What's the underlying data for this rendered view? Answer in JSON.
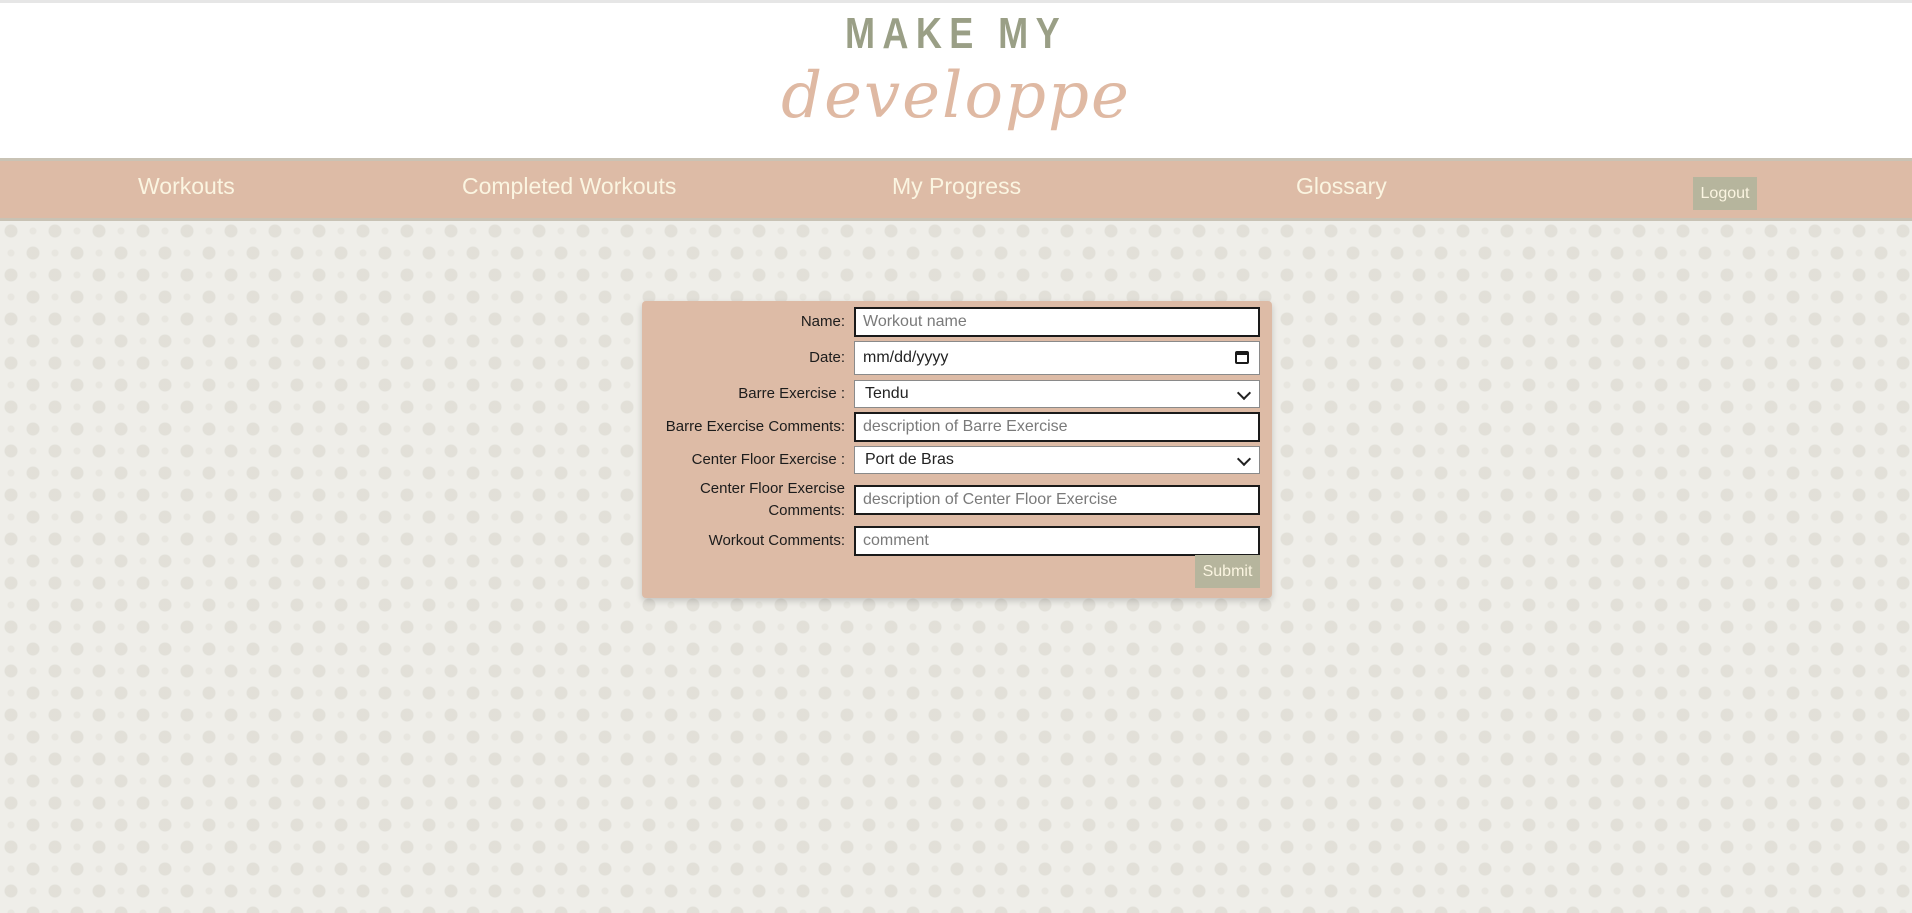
{
  "logo": {
    "line1": "MAKE MY",
    "line2": "developpe"
  },
  "nav": {
    "items": [
      {
        "label": "Workouts"
      },
      {
        "label": "Completed Workouts"
      },
      {
        "label": "My Progress"
      },
      {
        "label": "Glossary"
      }
    ],
    "logout_label": "Logout"
  },
  "form": {
    "name_label": "Name:",
    "name_placeholder": "Workout name",
    "date_label": "Date:",
    "date_value": "mm/dd/yyyy",
    "barre_label": "Barre Exercise :",
    "barre_selected": "Tendu",
    "barre_comments_label": "Barre Exercise Comments:",
    "barre_comments_placeholder": "description of Barre Exercise",
    "center_label": "Center Floor Exercise :",
    "center_selected": "Port de Bras",
    "center_comments_label_line1": "Center Floor Exercise",
    "center_comments_label_line2": "Comments:",
    "center_comments_placeholder": "description of Center Floor Exercise",
    "workout_comments_label": "Workout Comments:",
    "workout_comments_placeholder": "comment",
    "submit_label": "Submit"
  },
  "colors": {
    "accent": "#ddbba6",
    "button": "#b6b59d",
    "nav_text": "#fbf5e1",
    "logo_green": "#9a9f86",
    "logo_pink": "#dfb9a3",
    "page_bg": "#efeee9"
  },
  "icons": {
    "date_picker": "calendar-icon",
    "select_arrow": "chevron-down-icon"
  }
}
